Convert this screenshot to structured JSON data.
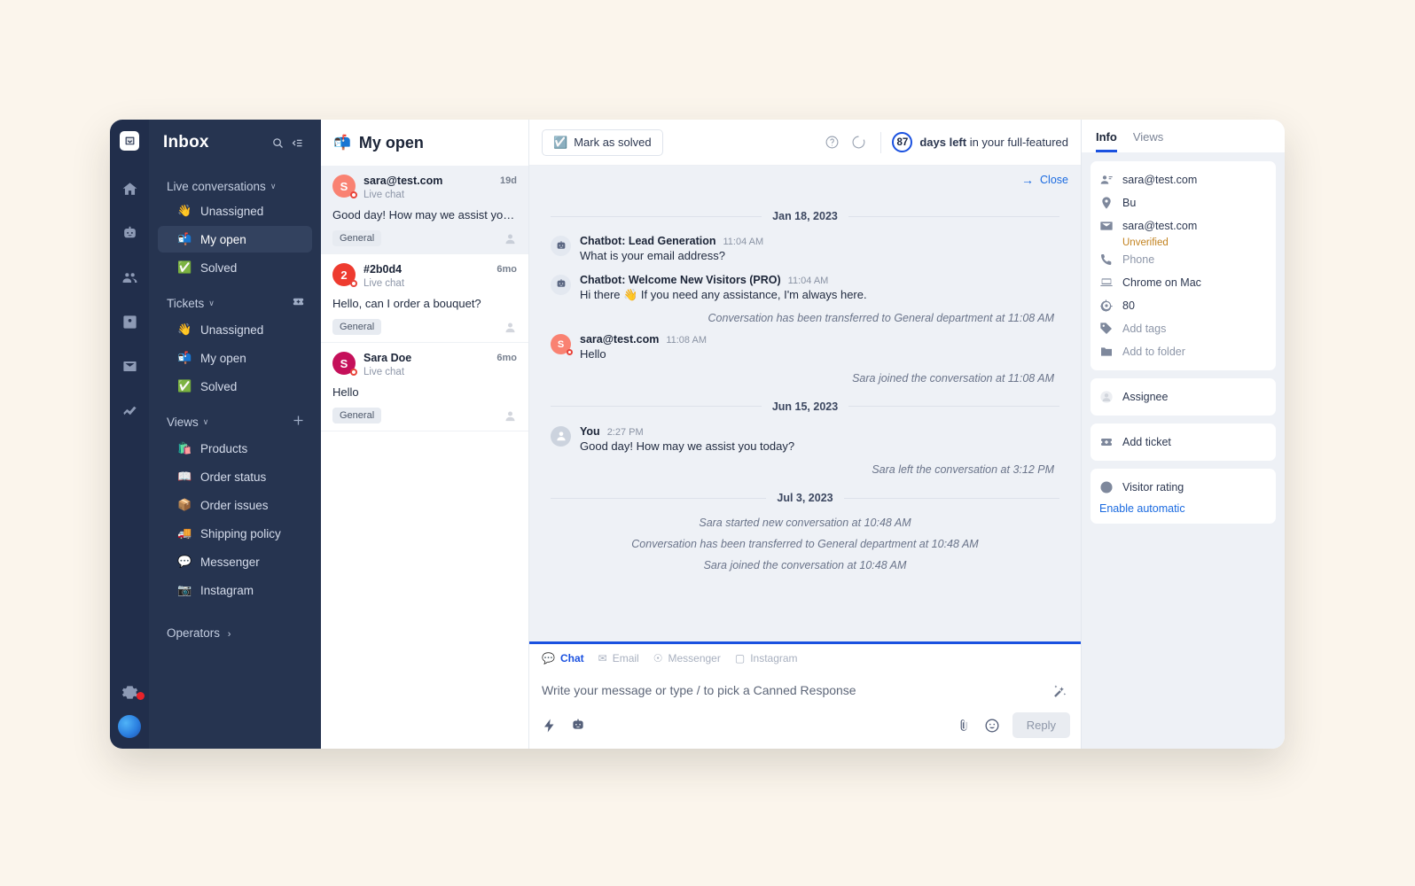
{
  "window": {
    "background_color": "#fbf5ec"
  },
  "icon_rail": {
    "logo_name": "livechat-logo",
    "items": [
      {
        "name": "home-icon",
        "label": "Home"
      },
      {
        "name": "chatbot-icon",
        "label": "Chatbot"
      },
      {
        "name": "team-icon",
        "label": "Team"
      },
      {
        "name": "contacts-icon",
        "label": "Contacts"
      },
      {
        "name": "inbox-mail-icon",
        "label": "Mail"
      },
      {
        "name": "reports-icon",
        "label": "Reports"
      }
    ],
    "settings_label": "Settings",
    "notification_dot_color": "#e8232a"
  },
  "sidebar": {
    "title": "Inbox",
    "search_label": "Search",
    "collapse_label": "Collapse",
    "sections": [
      {
        "label": "Live conversations",
        "caret": "∨",
        "action": null,
        "items": [
          {
            "emoji": "👋",
            "label": "Unassigned",
            "active": false
          },
          {
            "emoji": "📬",
            "label": "My open",
            "active": true
          },
          {
            "emoji": "✅",
            "label": "Solved",
            "active": false
          }
        ]
      },
      {
        "label": "Tickets",
        "caret": "∨",
        "action": "ticket-icon",
        "items": [
          {
            "emoji": "👋",
            "label": "Unassigned",
            "active": false
          },
          {
            "emoji": "📬",
            "label": "My open",
            "active": false
          },
          {
            "emoji": "✅",
            "label": "Solved",
            "active": false
          }
        ]
      },
      {
        "label": "Views",
        "caret": "∨",
        "action": "plus-icon",
        "items": [
          {
            "emoji": "🛍️",
            "label": "Products",
            "active": false
          },
          {
            "emoji": "📖",
            "label": "Order status",
            "active": false
          },
          {
            "emoji": "📦",
            "label": "Order issues",
            "active": false
          },
          {
            "emoji": "🚚",
            "label": "Shipping policy",
            "active": false
          },
          {
            "emoji": "💬",
            "label": "Messenger",
            "active": false
          },
          {
            "emoji": "📷",
            "label": "Instagram",
            "active": false
          }
        ]
      }
    ],
    "operators_label": "Operators",
    "operators_chevron": "›"
  },
  "conversation_list": {
    "header_emoji": "📬",
    "header_title": "My open",
    "items": [
      {
        "avatar_letter": "S",
        "avatar_color": "#f98272",
        "name": "sara@test.com",
        "channel": "Live chat",
        "time": "19d",
        "preview": "Good day! How may we assist you today?",
        "tag": "General",
        "selected": true
      },
      {
        "avatar_letter": "2",
        "avatar_color": "#ee3b2f",
        "name": "#2b0d4",
        "channel": "Live chat",
        "time": "6mo",
        "preview": "Hello, can I order a bouquet?",
        "tag": "General",
        "selected": false
      },
      {
        "avatar_letter": "S",
        "avatar_color": "#c5105a",
        "name": "Sara Doe",
        "channel": "Live chat",
        "time": "6mo",
        "preview": "Hello",
        "tag": "General",
        "selected": false
      }
    ]
  },
  "topbar": {
    "mark_solved_label": "Mark as solved",
    "mark_solved_icon": "☑️",
    "help_icon": "help-circle-icon",
    "refresh_icon": "status-circle-icon",
    "trial": {
      "days": "87",
      "bold_text": "days left",
      "rest_text": " in your full-featured",
      "accent_color": "#1a51e0"
    }
  },
  "chat": {
    "close_label": "Close",
    "close_arrow": "→",
    "thread": [
      {
        "type": "date",
        "label": "Jan 18, 2023"
      },
      {
        "type": "message",
        "avatar": "bot",
        "author": "Chatbot: Lead Generation",
        "time": "11:04 AM",
        "text": "What is your email address?"
      },
      {
        "type": "message",
        "avatar": "bot",
        "author": "Chatbot: Welcome New Visitors (PRO)",
        "time": "11:04 AM",
        "text": "Hi there 👋 If you need any assistance, I'm always here."
      },
      {
        "type": "system",
        "align": "right",
        "text": "Conversation has been transferred to General department at 11:08 AM"
      },
      {
        "type": "message",
        "avatar": "customer",
        "avatar_letter": "S",
        "avatar_color": "#f98272",
        "author": "sara@test.com",
        "time": "11:08 AM",
        "text": "Hello"
      },
      {
        "type": "system",
        "align": "right",
        "text": "Sara joined the conversation at 11:08 AM"
      },
      {
        "type": "date",
        "label": "Jun 15, 2023"
      },
      {
        "type": "message",
        "avatar": "you",
        "author": "You",
        "time": "2:27 PM",
        "text": "Good day! How may we assist you today?"
      },
      {
        "type": "system",
        "align": "right",
        "text": "Sara left the conversation at 3:12 PM"
      },
      {
        "type": "date",
        "label": "Jul 3, 2023"
      },
      {
        "type": "system",
        "align": "center",
        "text": "Sara started new conversation at 10:48 AM"
      },
      {
        "type": "system",
        "align": "center",
        "text": "Conversation has been transferred to General department at 10:48 AM"
      },
      {
        "type": "system",
        "align": "center",
        "text": "Sara joined the conversation at 10:48 AM"
      }
    ]
  },
  "composer": {
    "channels": [
      {
        "icon": "chat-icon",
        "label": "Chat",
        "active": true
      },
      {
        "icon": "email-icon",
        "label": "Email",
        "active": false
      },
      {
        "icon": "messenger-icon",
        "label": "Messenger",
        "active": false
      },
      {
        "icon": "instagram-icon",
        "label": "Instagram",
        "active": false
      }
    ],
    "placeholder": "Write your message or type / to pick a Canned Response",
    "ai_icon": "magic-wand-icon",
    "tools": [
      {
        "name": "quick-reply-icon"
      },
      {
        "name": "chatbot-suggest-icon"
      },
      {
        "name": "attachment-icon"
      },
      {
        "name": "emoji-icon"
      }
    ],
    "reply_label": "Reply"
  },
  "info_panel": {
    "tabs": [
      {
        "label": "Info",
        "active": true
      },
      {
        "label": "Views",
        "active": false
      }
    ],
    "details": [
      {
        "icon": "person-card-icon",
        "value": "sara@test.com"
      },
      {
        "icon": "location-pin-icon",
        "value": "Bu"
      },
      {
        "icon": "envelope-icon",
        "value": "sara@test.com",
        "sub": "Unverified"
      },
      {
        "icon": "phone-icon",
        "value": "Phone",
        "muted": true
      },
      {
        "icon": "laptop-icon",
        "value": "Chrome on Mac"
      },
      {
        "icon": "target-icon",
        "value": "80"
      },
      {
        "icon": "tag-icon",
        "value": "Add tags",
        "muted": true
      },
      {
        "icon": "folder-icon",
        "value": "Add to folder",
        "muted": true
      }
    ],
    "assignee": {
      "icon": "avatar-icon",
      "label": "Assignee"
    },
    "ticket": {
      "icon": "ticket-icon",
      "label": "Add ticket"
    },
    "visitor": {
      "icon": "smiley-icon",
      "label": "Visitor rating"
    },
    "enable_link": "Enable automatic"
  }
}
